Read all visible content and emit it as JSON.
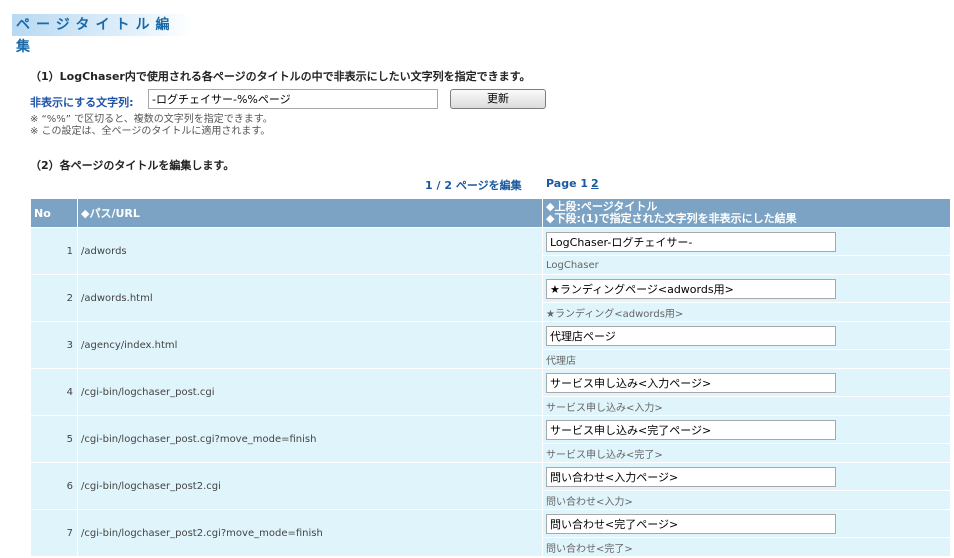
{
  "page": {
    "title": "ページタイトル編集"
  },
  "section1": {
    "heading": "（1）LogChaser内で使用される各ページのタイトルの中で非表示にしたい文字列を指定できます。",
    "label": "非表示にする文字列:",
    "value": "-ログチェイサー-%%ページ",
    "button": "更新",
    "note1": "※ “%%” で区切ると、複数の文字列を指定できます。",
    "note2": "※ この設定は、全ページのタイトルに適用されます。"
  },
  "section2": {
    "heading": "（2）各ページのタイトルを編集します。",
    "pager_summary": "1 / 2 ページを編集",
    "pager_label": "Page 1",
    "pager_link": "2"
  },
  "table": {
    "col_no": "No",
    "col_path": "◆パス/URL",
    "col_title_line1": "◆上段:ページタイトル",
    "col_title_line2": "◆下段:(1)で指定された文字列を非表示にした結果",
    "rows": [
      {
        "no": "1",
        "path": "/adwords",
        "title": "LogChaser-ログチェイサー-",
        "result": "LogChaser"
      },
      {
        "no": "2",
        "path": "/adwords.html",
        "title": "★ランディングページ<adwords用>",
        "result": "★ランディング<adwords用>"
      },
      {
        "no": "3",
        "path": "/agency/index.html",
        "title": "代理店ページ",
        "result": "代理店"
      },
      {
        "no": "4",
        "path": "/cgi-bin/logchaser_post.cgi",
        "title": "サービス申し込み<入力ページ>",
        "result": "サービス申し込み<入力>"
      },
      {
        "no": "5",
        "path": "/cgi-bin/logchaser_post.cgi?move_mode=finish",
        "title": "サービス申し込み<完了ページ>",
        "result": "サービス申し込み<完了>"
      },
      {
        "no": "6",
        "path": "/cgi-bin/logchaser_post2.cgi",
        "title": "問い合わせ<入力ページ>",
        "result": "問い合わせ<入力>"
      },
      {
        "no": "7",
        "path": "/cgi-bin/logchaser_post2.cgi?move_mode=finish",
        "title": "問い合わせ<完了ページ>",
        "result": "問い合わせ<完了>"
      }
    ]
  }
}
